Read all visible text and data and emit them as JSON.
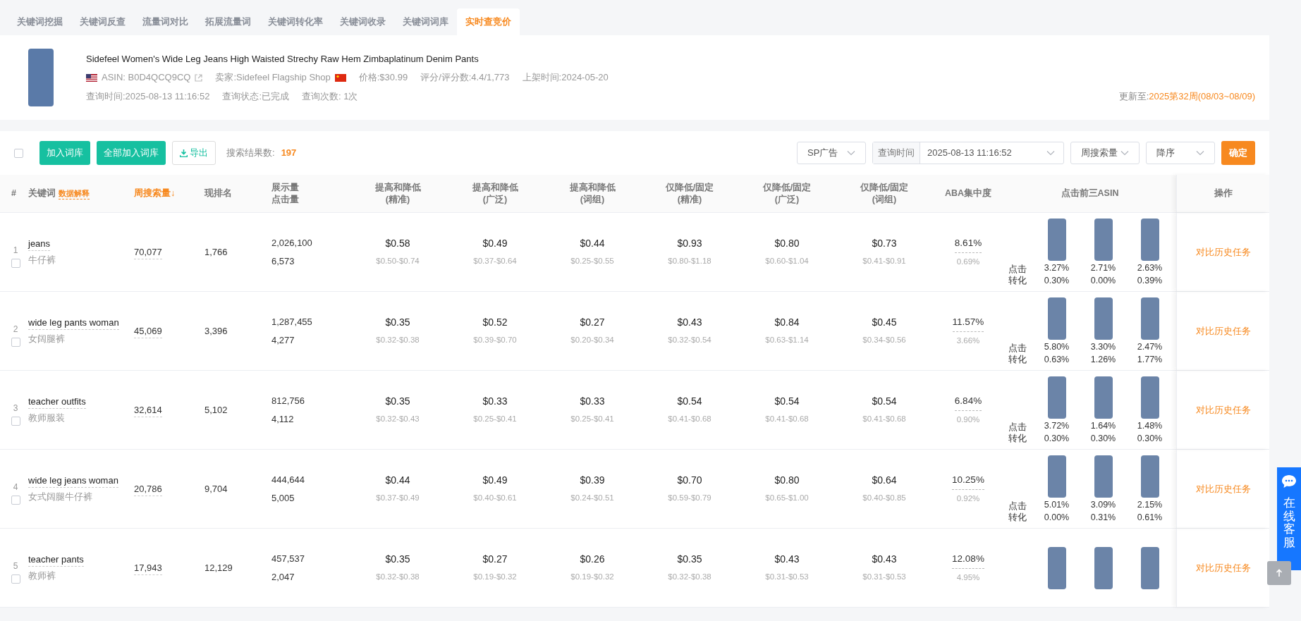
{
  "tabs": [
    {
      "label": "关键词挖掘",
      "selected": false
    },
    {
      "label": "关键词反查",
      "selected": false
    },
    {
      "label": "流量词对比",
      "selected": false
    },
    {
      "label": "拓展流量词",
      "selected": false
    },
    {
      "label": "关键词转化率",
      "selected": false
    },
    {
      "label": "关键词收录",
      "selected": false
    },
    {
      "label": "关键词词库",
      "selected": false
    },
    {
      "label": "实时查竞价",
      "selected": true
    }
  ],
  "product": {
    "title": "Sidefeel Women's Wide Leg Jeans High Waisted Strechy Raw Hem Zimbaplatinum Denim Pants",
    "asin": "ASIN: B0D4QCQ9CQ",
    "seller": "卖家:Sidefeel Flagship Shop",
    "price": "价格:$30.99",
    "rating": "评分/评分数:4.4/1,773",
    "listed": "上架时间:2024-05-20",
    "query_time": "查询时间:2025-08-13 11:16:52",
    "query_status": "查询状态:已完成",
    "query_count": "查询次数: 1次",
    "update_label": "更新至:",
    "update_value": "2025第32周(08/03~08/09)"
  },
  "toolbar": {
    "select_all_checked": false,
    "add_button": "加入词库",
    "add_all_button": "全部加入词库",
    "export_button": "导出",
    "result_label": "搜索结果数:",
    "result_count": "197",
    "ad_type": "SP广告",
    "time_label": "查询时间",
    "time_value": "2025-08-13 11:16:52",
    "sort_field": "周搜索量",
    "sort_order": "降序",
    "confirm_button": "确定"
  },
  "columns": [
    {
      "label": "#",
      "sorted": false
    },
    {
      "label": "关键词",
      "sorted": false,
      "link": "数据解释"
    },
    {
      "label": "周搜索量↓",
      "sorted": true
    },
    {
      "label": "现排名",
      "sorted": false
    },
    {
      "label": "展示量",
      "label2": "点击量",
      "sorted": false
    },
    {
      "label": "提高和降低",
      "label2": "(精准)",
      "sorted": false
    },
    {
      "label": "提高和降低",
      "label2": "(广泛)",
      "sorted": false
    },
    {
      "label": "提高和降低",
      "label2": "(词组)",
      "sorted": false
    },
    {
      "label": "仅降低/固定",
      "label2": "(精准)",
      "sorted": false
    },
    {
      "label": "仅降低/固定",
      "label2": "(广泛)",
      "sorted": false
    },
    {
      "label": "仅降低/固定",
      "label2": "(词组)",
      "sorted": false
    },
    {
      "label": "ABA集中度",
      "sorted": false
    },
    {
      "label": "点击前三ASIN",
      "sorted": false
    },
    {
      "label": "操作",
      "sorted": false
    }
  ],
  "rows": [
    {
      "index": "1",
      "checked": false,
      "keyword": "jeans",
      "keyword_cn": "牛仔裤",
      "weekly_search": "70,077",
      "rank": "1,766",
      "impressions": "2,026,100",
      "clicks": "6,573",
      "bids": [
        {
          "bid": "$0.58",
          "range": "$0.50-$0.74"
        },
        {
          "bid": "$0.49",
          "range": "$0.37-$0.64"
        },
        {
          "bid": "$0.44",
          "range": "$0.25-$0.55"
        },
        {
          "bid": "$0.93",
          "range": "$0.80-$1.18"
        },
        {
          "bid": "$0.80",
          "range": "$0.60-$1.04"
        },
        {
          "bid": "$0.73",
          "range": "$0.41-$0.91"
        }
      ],
      "aba": "8.61%",
      "aba_sub": "0.69%",
      "asin_labels": [
        "点击",
        "转化"
      ],
      "asins": [
        {
          "click": "3.27%",
          "conv": "0.30%"
        },
        {
          "click": "2.71%",
          "conv": "0.00%"
        },
        {
          "click": "2.63%",
          "conv": "0.39%"
        }
      ],
      "action": "对比历史任务"
    },
    {
      "index": "2",
      "checked": false,
      "keyword": "wide leg pants woman",
      "keyword_cn": "女阔腿裤",
      "weekly_search": "45,069",
      "rank": "3,396",
      "impressions": "1,287,455",
      "clicks": "4,277",
      "bids": [
        {
          "bid": "$0.35",
          "range": "$0.32-$0.38"
        },
        {
          "bid": "$0.52",
          "range": "$0.39-$0.70"
        },
        {
          "bid": "$0.27",
          "range": "$0.20-$0.34"
        },
        {
          "bid": "$0.43",
          "range": "$0.32-$0.54"
        },
        {
          "bid": "$0.84",
          "range": "$0.63-$1.14"
        },
        {
          "bid": "$0.45",
          "range": "$0.34-$0.56"
        }
      ],
      "aba": "11.57%",
      "aba_sub": "3.66%",
      "asin_labels": [
        "点击",
        "转化"
      ],
      "asins": [
        {
          "click": "5.80%",
          "conv": "0.63%"
        },
        {
          "click": "3.30%",
          "conv": "1.26%"
        },
        {
          "click": "2.47%",
          "conv": "1.77%"
        }
      ],
      "action": "对比历史任务"
    },
    {
      "index": "3",
      "checked": false,
      "keyword": "teacher outfits",
      "keyword_cn": "教师服装",
      "weekly_search": "32,614",
      "rank": "5,102",
      "impressions": "812,756",
      "clicks": "4,112",
      "bids": [
        {
          "bid": "$0.35",
          "range": "$0.32-$0.43"
        },
        {
          "bid": "$0.33",
          "range": "$0.25-$0.41"
        },
        {
          "bid": "$0.33",
          "range": "$0.25-$0.41"
        },
        {
          "bid": "$0.54",
          "range": "$0.41-$0.68"
        },
        {
          "bid": "$0.54",
          "range": "$0.41-$0.68"
        },
        {
          "bid": "$0.54",
          "range": "$0.41-$0.68"
        }
      ],
      "aba": "6.84%",
      "aba_sub": "0.90%",
      "asin_labels": [
        "点击",
        "转化"
      ],
      "asins": [
        {
          "click": "3.72%",
          "conv": "0.30%"
        },
        {
          "click": "1.64%",
          "conv": "0.30%"
        },
        {
          "click": "1.48%",
          "conv": "0.30%"
        }
      ],
      "action": "对比历史任务"
    },
    {
      "index": "4",
      "checked": false,
      "keyword": "wide leg jeans woman",
      "keyword_cn": "女式阔腿牛仔裤",
      "weekly_search": "20,786",
      "rank": "9,704",
      "impressions": "444,644",
      "clicks": "5,005",
      "bids": [
        {
          "bid": "$0.44",
          "range": "$0.37-$0.49"
        },
        {
          "bid": "$0.49",
          "range": "$0.40-$0.61"
        },
        {
          "bid": "$0.39",
          "range": "$0.24-$0.51"
        },
        {
          "bid": "$0.70",
          "range": "$0.59-$0.79"
        },
        {
          "bid": "$0.80",
          "range": "$0.65-$1.00"
        },
        {
          "bid": "$0.64",
          "range": "$0.40-$0.85"
        }
      ],
      "aba": "10.25%",
      "aba_sub": "0.92%",
      "asin_labels": [
        "点击",
        "转化"
      ],
      "asins": [
        {
          "click": "5.01%",
          "conv": "0.00%"
        },
        {
          "click": "3.09%",
          "conv": "0.31%"
        },
        {
          "click": "2.15%",
          "conv": "0.61%"
        }
      ],
      "action": "对比历史任务"
    },
    {
      "index": "5",
      "checked": false,
      "keyword": "teacher pants",
      "keyword_cn": "教师裤",
      "weekly_search": "17,943",
      "rank": "12,129",
      "impressions": "457,537",
      "clicks": "2,047",
      "bids": [
        {
          "bid": "$0.35",
          "range": "$0.32-$0.38"
        },
        {
          "bid": "$0.27",
          "range": "$0.19-$0.32"
        },
        {
          "bid": "$0.26",
          "range": "$0.19-$0.32"
        },
        {
          "bid": "$0.35",
          "range": "$0.32-$0.38"
        },
        {
          "bid": "$0.43",
          "range": "$0.31-$0.53"
        },
        {
          "bid": "$0.43",
          "range": "$0.31-$0.53"
        }
      ],
      "aba": "12.08%",
      "aba_sub": "4.95%",
      "asins": [
        {
          "kind": "photo"
        },
        {
          "kind": "photo"
        },
        {
          "kind": "photo"
        }
      ],
      "action": "对比历史任务"
    }
  ],
  "chat_widget": {
    "label": "在线客服"
  }
}
